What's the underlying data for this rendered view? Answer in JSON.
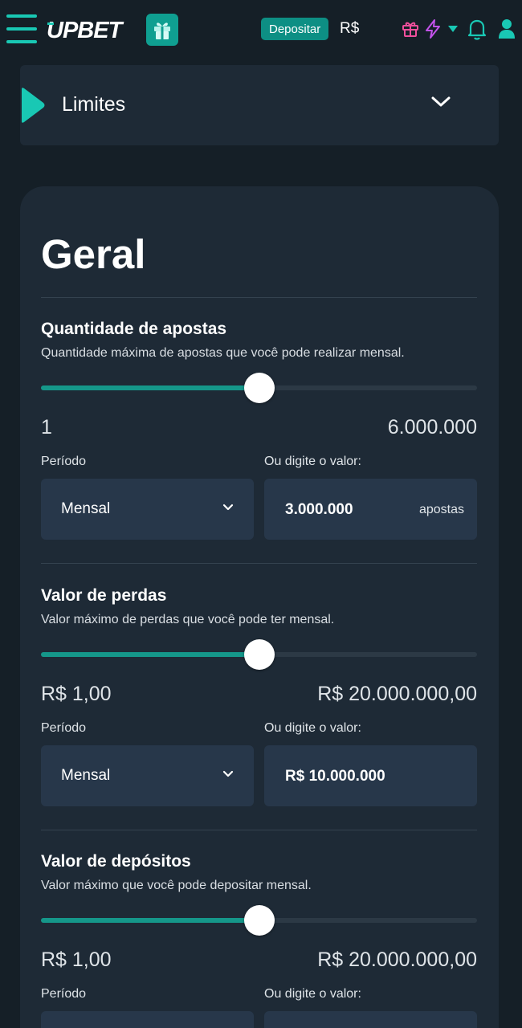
{
  "header": {
    "logo_text": "UPBET",
    "deposit_label": "Depositar",
    "currency": "R$",
    "colors": {
      "accent": "#19c8b4",
      "deposit_bg": "#0d8f84",
      "gift_pink": "#ef4f9c",
      "bolt_purple": "#c252e8"
    },
    "icons": [
      "menu-icon",
      "gift-icon",
      "gift-icon",
      "lightning-icon",
      "caret-down-icon",
      "bell-icon",
      "user-icon"
    ]
  },
  "limits": {
    "title": "Limites"
  },
  "card": {
    "title": "Geral",
    "sections": [
      {
        "title": "Quantidade de apostas",
        "description": "Quantidade máxima de apostas que você pode realizar mensal.",
        "slider_fraction": 0.5,
        "min_label": "1",
        "max_label": "6.000.000",
        "period_label": "Período",
        "period_value": "Mensal",
        "input_label": "Ou digite o valor:",
        "input_value": "3.000.000",
        "input_unit": "apostas"
      },
      {
        "title": "Valor de perdas",
        "description": "Valor máximo de perdas que você pode ter mensal.",
        "slider_fraction": 0.5,
        "min_label": "R$ 1,00",
        "max_label": "R$ 20.000.000,00",
        "period_label": "Período",
        "period_value": "Mensal",
        "input_label": "Ou digite o valor:",
        "input_value": "R$ 10.000.000",
        "input_unit": ""
      },
      {
        "title": "Valor de depósitos",
        "description": "Valor máximo que você pode depositar mensal.",
        "slider_fraction": 0.5,
        "min_label": "R$ 1,00",
        "max_label": "R$ 20.000.000,00",
        "period_label": "Período",
        "period_value": "",
        "input_label": "Ou digite o valor:",
        "input_value": "",
        "input_unit": ""
      }
    ]
  }
}
